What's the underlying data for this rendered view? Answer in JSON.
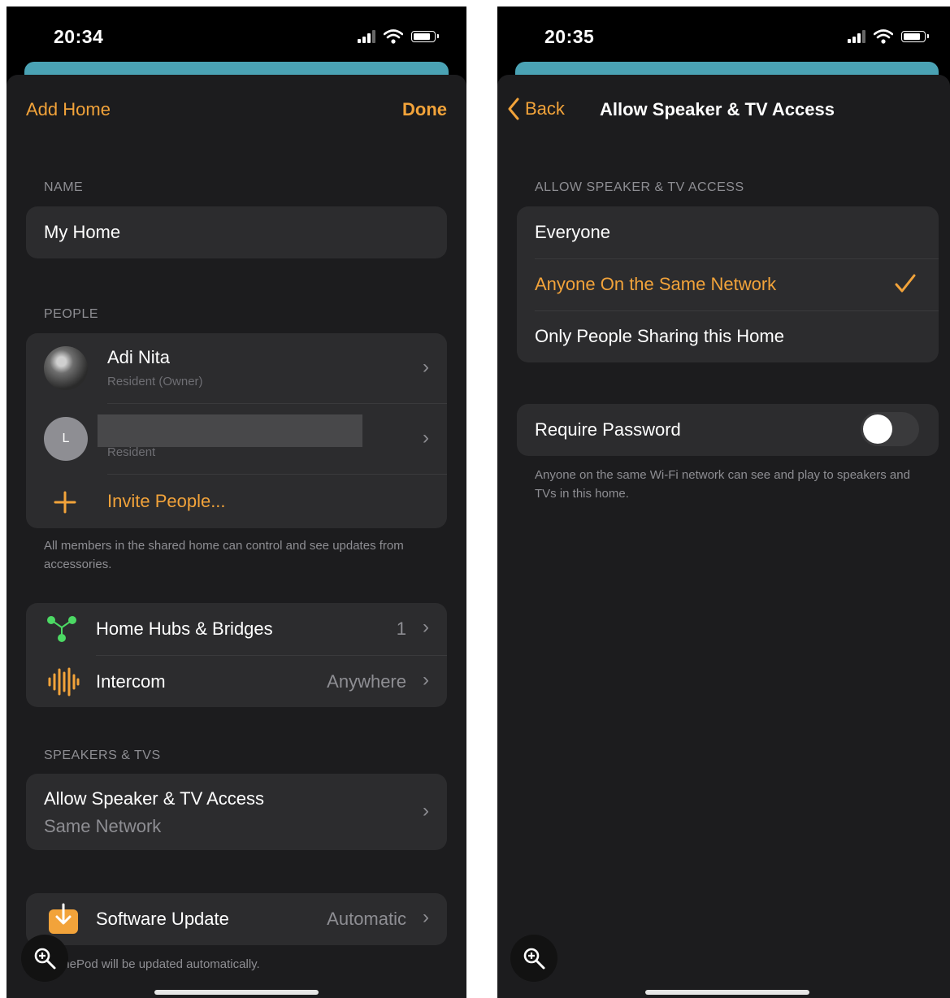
{
  "left": {
    "time": "20:34",
    "nav": {
      "left": "Add Home",
      "right": "Done"
    },
    "name_section": {
      "header": "NAME",
      "value": "My Home"
    },
    "people_section": {
      "header": "PEOPLE",
      "people": [
        {
          "name": "Adi Nita",
          "role": "Resident (Owner)"
        },
        {
          "initial": "L",
          "name": "",
          "role": "Resident"
        }
      ],
      "invite": "Invite People...",
      "footnote": "All members in the shared home can control and see updates from accessories."
    },
    "hubs": {
      "label": "Home Hubs & Bridges",
      "value": "1"
    },
    "intercom": {
      "label": "Intercom",
      "value": "Anywhere"
    },
    "speakers_section": {
      "header": "SPEAKERS & TVS",
      "title": "Allow Speaker & TV Access",
      "subtitle": "Same Network"
    },
    "software": {
      "label": "Software Update",
      "value": "Automatic"
    },
    "software_footnote": "HomePod will be updated automatically."
  },
  "right": {
    "time": "20:35",
    "nav": {
      "back": "Back",
      "title": "Allow Speaker & TV Access"
    },
    "section_header": "ALLOW SPEAKER & TV ACCESS",
    "options": [
      "Everyone",
      "Anyone On the Same Network",
      "Only People Sharing this Home"
    ],
    "selected_option": "Anyone On the Same Network",
    "password": {
      "label": "Require Password",
      "enabled": false
    },
    "footnote": "Anyone on the same Wi-Fi network can see and play to speakers and TVs in this home."
  },
  "colors": {
    "accent": "#f2a33a",
    "background": "#1c1c1e",
    "cell": "#2c2c2e",
    "secondary": "#8e8e93",
    "teal": "#4aa2b4"
  },
  "icons": [
    "signal-icon",
    "wifi-icon",
    "battery-icon",
    "chevron-right-icon",
    "plus-icon",
    "hub-icon",
    "intercom-icon",
    "software-update-icon",
    "zoom-icon",
    "checkmark-icon",
    "chevron-left-icon"
  ]
}
